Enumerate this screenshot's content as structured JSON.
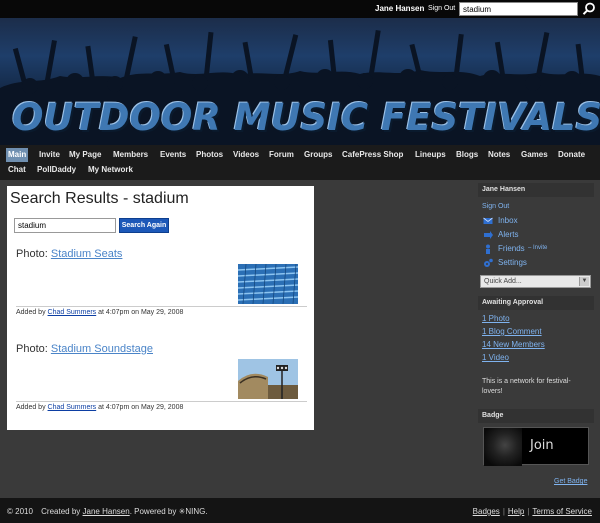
{
  "topbar": {
    "user_name": "Jane Hansen",
    "sign_out": "Sign Out",
    "search_value": "stadium"
  },
  "header": {
    "logo_text": "OUTDOOR MUSIC FESTIVALS"
  },
  "nav": {
    "row1": [
      "Main",
      "Invite",
      "My Page",
      "Members",
      "Events",
      "Photos",
      "Videos",
      "Forum",
      "Groups",
      "CafePress Shop",
      "Lineups",
      "Blogs",
      "Notes",
      "Games",
      "Donate"
    ],
    "row2": [
      "Chat",
      "PollDaddy",
      "My Network"
    ],
    "active": "Main"
  },
  "main": {
    "title": "Search Results - stadium",
    "search_value": "stadium",
    "search_button": "Search Again",
    "results": [
      {
        "prefix": "Photo: ",
        "link": "Stadium Seats",
        "added_by_label": "Added by",
        "author": "Chad Summers",
        "time": "at 4:07pm on May 29, 2008"
      },
      {
        "prefix": "Photo: ",
        "link": "Stadium Soundstage",
        "added_by_label": "Added by",
        "author": "Chad Summers",
        "time": "at 4:07pm on May 29, 2008"
      }
    ]
  },
  "sidebar": {
    "user_head": "Jane Hansen",
    "sign_out": "Sign Out",
    "inbox": "Inbox",
    "alerts": "Alerts",
    "friends": "Friends",
    "friends_invite": "– Invite",
    "settings": "Settings",
    "quick_add": "Quick Add...",
    "awaiting_head": "Awaiting Approval",
    "awaiting": [
      "1 Photo",
      "1 Blog Comment",
      "14 New Members",
      "1 Video"
    ],
    "network_text": "This is a network for festival-lovers!",
    "badge_head": "Badge",
    "join_text": "Join",
    "get_badge": "Get Badge",
    "link_color": "#7fb3ef"
  },
  "footer": {
    "copyright": "© 2010",
    "created_by": "Created by",
    "creator": "Jane Hansen",
    "powered_by": ". Powered by",
    "ning": "NING.",
    "links": [
      "Badges",
      "Help",
      "Terms of Service"
    ]
  },
  "colors": {
    "nav_active": "#6f8fb0",
    "search_button": "#1c58b8",
    "link": "#0c3ea3"
  }
}
